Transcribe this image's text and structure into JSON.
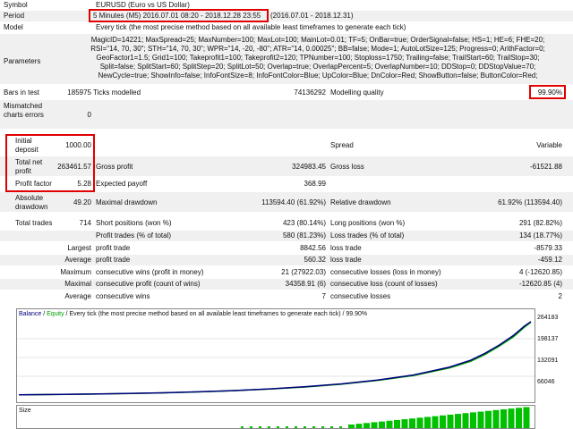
{
  "header": {
    "symbol_label": "Symbol",
    "symbol_value": "EURUSD (Euro vs US Dollar)",
    "period_label": "Period",
    "period_value": "5 Minutes (M5) 2016.07.01 08:20 - 2018.12.28 23:55",
    "period_range": "(2016.07.01 - 2018.12.31)",
    "model_label": "Model",
    "model_value": "Every tick (the most precise method based on all available least timeframes to generate each tick)",
    "parameters_label": "Parameters",
    "parameters_lines": [
      "MagicID=14221; MaxSpread=25; MaxNumber=100; MaxLot=100; MainLot=0.01; TF=5; OnBar=true; OrderSignal=false; HS=1; HE=6; FHE=20;",
      "RSI=\"14, 70, 30\"; STH=\"14, 70, 30\"; WPR=\"14, -20, -80\"; ATR=\"14, 0.00025\"; BB=false; Mode=1; AutoLotSize=125; Progress=0; ArithFactor=0;",
      "GeoFactor1=1.5; Grid1=100; Takeprofit1=100; Takeprofit2=120; TPNumber=100; Stoploss=1750; Trailing=false; TrailStart=60; TrailStop=30;",
      "Split=false; SplitStart=60; SplitStep=20; SplitLot=50; Overlap=true; OverlapPercent=5; OverlapNumber=10; DDStop=0; DDStopValue=70;",
      "NewCycle=true; ShowInfo=false; InfoFontSize=8; InfoFontColor=Blue; UpColor=Blue; DnColor=Red; ShowButton=false; ButtonColor=Red;"
    ]
  },
  "bars": {
    "bars_label": "Bars in test",
    "bars_value": "185975",
    "ticks_label": "Ticks modelled",
    "ticks_value": "74136292",
    "quality_label": "Modelling quality",
    "quality_value": "99.90%",
    "mismatch_label": "Mismatched charts errors",
    "mismatch_value": "0"
  },
  "deposit": {
    "initial_label": "Initial deposit",
    "initial_value": "1000.00",
    "spread_label": "Spread",
    "spread_value": "Variable",
    "net_label": "Total net profit",
    "net_value": "263461.57",
    "gross_profit_label": "Gross profit",
    "gross_profit_value": "324983.45",
    "gross_loss_label": "Gross loss",
    "gross_loss_value": "-61521.88",
    "pf_label": "Profit factor",
    "pf_value": "5.28",
    "payoff_label": "Expected payoff",
    "payoff_value": "368.99",
    "abs_dd_label": "Absolute drawdown",
    "abs_dd_value": "49.20",
    "max_dd_label": "Maximal drawdown",
    "max_dd_value": "113594.40 (61.92%)",
    "rel_dd_label": "Relative drawdown",
    "rel_dd_value": "61.92% (113594.40)"
  },
  "trades": {
    "total_label": "Total trades",
    "total_value": "714",
    "short_label": "Short positions (won %)",
    "short_value": "423 (80.14%)",
    "long_label": "Long positions (won %)",
    "long_value": "291 (82.82%)",
    "pt_label": "Profit trades (% of total)",
    "pt_value": "580 (81.23%)",
    "lt_label": "Loss trades (% of total)",
    "lt_value": "134 (18.77%)",
    "largest": "Largest",
    "average": "Average",
    "maximum": "Maximum",
    "maximal": "Maximal",
    "profit_trade": "profit trade",
    "loss_trade": "loss trade",
    "largest_profit": "8842.56",
    "largest_loss": "-8579.33",
    "average_profit": "560.32",
    "average_loss": "-459.12",
    "cw_money_label": "consecutive wins (profit in money)",
    "cw_money_value": "21 (27922.03)",
    "cl_money_label": "consecutive losses (loss in money)",
    "cl_money_value": "4 (-12620.85)",
    "cw_count_label": "consecutive profit (count of wins)",
    "cw_count_value": "34358.91 (6)",
    "cl_count_label": "consecutive loss (count of losses)",
    "cl_count_value": "-12620.85 (4)",
    "acw_label": "consecutive wins",
    "acw_value": "7",
    "acl_label": "consecutive losses",
    "acl_value": "2"
  },
  "chart_header": {
    "balance": "Balance",
    "sep": " / ",
    "equity": "Equity",
    "desc": " / Every tick (the most precise method based on all available least timeframes to generate each tick) / 99.90%",
    "size_label": "Size"
  },
  "chart_data": {
    "type": "line",
    "yticks": [
      "264183",
      "198137",
      "132091",
      "66046"
    ],
    "ylim": [
      0,
      270000
    ],
    "xlim": [
      0,
      714
    ],
    "series": [
      {
        "name": "Balance",
        "color": "#00007f",
        "x": [
          0,
          50,
          100,
          150,
          200,
          250,
          300,
          350,
          400,
          450,
          500,
          550,
          600,
          630,
          650,
          670,
          690,
          705,
          714
        ],
        "y": [
          1000,
          2000,
          3500,
          5500,
          8000,
          11500,
          16000,
          22000,
          30000,
          40000,
          54000,
          72000,
          100000,
          125000,
          150000,
          180000,
          215000,
          248000,
          264183
        ]
      },
      {
        "name": "Equity",
        "color": "#00a000",
        "x": [
          0,
          50,
          100,
          150,
          200,
          250,
          300,
          350,
          400,
          450,
          500,
          550,
          600,
          630,
          650,
          670,
          690,
          705,
          714
        ],
        "y": [
          1000,
          1900,
          3400,
          5300,
          7800,
          11200,
          15600,
          21500,
          29000,
          39000,
          52500,
          70000,
          97000,
          121000,
          146000,
          176000,
          210000,
          244000,
          262000
        ]
      }
    ],
    "size_color": "#00c000",
    "colors": {
      "highlight": "#e00000",
      "band": "#f0f0f0"
    }
  }
}
